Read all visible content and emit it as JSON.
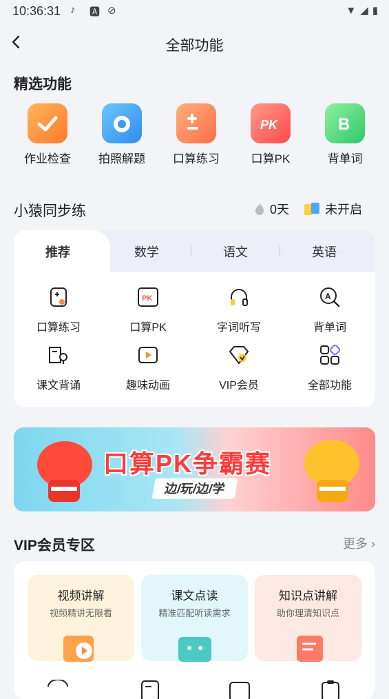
{
  "status": {
    "time": "10:36:31"
  },
  "header": {
    "title": "全部功能"
  },
  "featured": {
    "title": "精选功能",
    "items": [
      {
        "label": "作业检查",
        "icon": "homework-check-icon"
      },
      {
        "label": "拍照解题",
        "icon": "camera-icon"
      },
      {
        "label": "口算练习",
        "icon": "calc-icon"
      },
      {
        "label": "口算PK",
        "icon": "pk-icon"
      },
      {
        "label": "背单词",
        "icon": "word-b-icon"
      }
    ]
  },
  "sync": {
    "title": "小猿同步练",
    "streak_days": "0天",
    "status": "未开启",
    "tabs": [
      "推荐",
      "数学",
      "语文",
      "英语"
    ],
    "grid": [
      {
        "label": "口算练习"
      },
      {
        "label": "口算PK"
      },
      {
        "label": "字词听写"
      },
      {
        "label": "背单词"
      },
      {
        "label": "课文背诵"
      },
      {
        "label": "趣味动画"
      },
      {
        "label": "VIP会员"
      },
      {
        "label": "全部功能"
      }
    ]
  },
  "banner": {
    "title": "口算PK争霸赛",
    "subtitle": "边/玩/边/学"
  },
  "vip": {
    "title": "VIP会员专区",
    "more": "更多",
    "tiles": [
      {
        "title": "视频讲解",
        "subtitle": "视频精讲无限看",
        "color": "#fdf3dc"
      },
      {
        "title": "课文点读",
        "subtitle": "精准匹配听读需求",
        "color": "#e1f7fa"
      },
      {
        "title": "知识点讲解",
        "subtitle": "助你理清知识点",
        "color": "#fde9e4"
      }
    ]
  },
  "colors": {
    "accent": "#ff8a3d",
    "blue": "#3aa0f0",
    "green": "#4bd27a",
    "red": "#ff5b52"
  }
}
